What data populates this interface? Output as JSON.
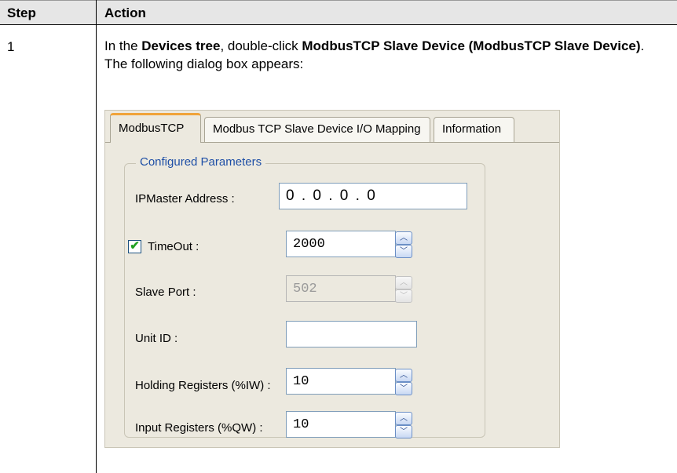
{
  "table": {
    "header_step": "Step",
    "header_action": "Action",
    "step_number": "1",
    "action": {
      "intro_prefix": "In the ",
      "devices_tree": "Devices tree",
      "intro_middle": ", double-click ",
      "device_name": "ModbusTCP Slave Device (ModbusTCP Slave Device)",
      "intro_suffix": ".",
      "dialog_sentence": "The following dialog box appears:"
    }
  },
  "dialog": {
    "tabs": [
      {
        "label": "ModbusTCP",
        "active": true
      },
      {
        "label": "Modbus TCP Slave Device I/O Mapping",
        "active": false
      },
      {
        "label": "Information",
        "active": false
      }
    ],
    "group_title": "Configured Parameters",
    "ip_master": {
      "label": "IPMaster Address :",
      "value": "0 . 0 . 0 . 0"
    },
    "timeout": {
      "label": "TimeOut :",
      "value": "2000",
      "checked": true,
      "check_glyph": "✔"
    },
    "slave_port": {
      "label": "Slave Port :",
      "value": "502",
      "disabled": true
    },
    "unit_id": {
      "label": "Unit ID :",
      "value": ""
    },
    "holding_registers": {
      "label": "Holding Registers (%IW) :",
      "value": "10"
    },
    "input_registers": {
      "label": "Input Registers (%QW) :",
      "value": "10"
    },
    "spin_up_icon": "chevron-up-icon",
    "spin_down_icon": "chevron-down-icon",
    "spin_up_glyph": "︿",
    "spin_down_glyph": "﹀"
  },
  "colors": {
    "header_bg": "#e6e6e6",
    "dialog_bg": "#ece9df",
    "tab_accent": "#f0a33a",
    "group_title": "#1e4fa6",
    "check": "#21a121"
  }
}
